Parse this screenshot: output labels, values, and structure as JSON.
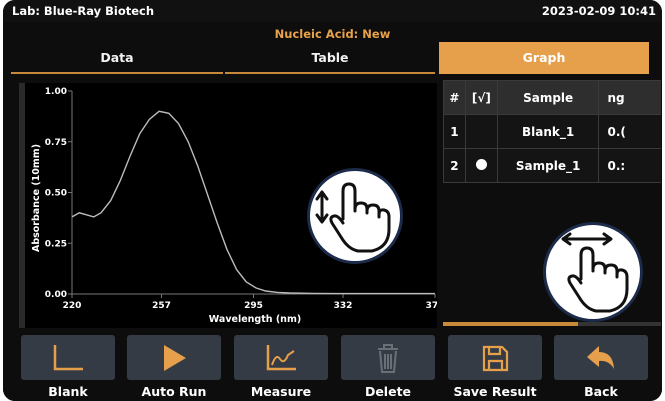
{
  "status": {
    "lab": "Lab: Blue-Ray Biotech",
    "datetime": "2023-02-09 10:41"
  },
  "mode_title": "Nucleic Acid: New",
  "tabs": [
    {
      "label": "Data"
    },
    {
      "label": "Table"
    },
    {
      "label": "Graph",
      "active": true
    }
  ],
  "colors": {
    "accent": "#e6a04c",
    "background": "#0d0d0d",
    "button": "#353b45",
    "curve": "#bbbbbb"
  },
  "chart_data": {
    "type": "line",
    "xlabel": "Wavelength (nm)",
    "ylabel": "Absorbance (10mm)",
    "xlim": [
      220,
      370
    ],
    "ylim": [
      0,
      1.0
    ],
    "x_ticks": [
      "220",
      "257",
      "295",
      "332",
      "370"
    ],
    "y_ticks": [
      "0.00",
      "0.25",
      "0.50",
      "0.75",
      "1.00"
    ],
    "series": [
      {
        "x": [
          220,
          223,
          226,
          229,
          232,
          236,
          240,
          244,
          248,
          252,
          256,
          260,
          264,
          268,
          272,
          276,
          280,
          284,
          288,
          292,
          296,
          300,
          305,
          310,
          320,
          330,
          345,
          360,
          370
        ],
        "y": [
          0.38,
          0.4,
          0.39,
          0.38,
          0.4,
          0.46,
          0.56,
          0.68,
          0.79,
          0.86,
          0.9,
          0.89,
          0.84,
          0.75,
          0.63,
          0.49,
          0.35,
          0.22,
          0.12,
          0.06,
          0.03,
          0.015,
          0.008,
          0.005,
          0.003,
          0.002,
          0.002,
          0.002,
          0.002
        ]
      }
    ]
  },
  "table": {
    "headers": [
      "#",
      "[√]",
      "Sample",
      "ng"
    ],
    "rows": [
      {
        "num": "1",
        "check": "",
        "sample": "Blank_1",
        "value": "0.("
      },
      {
        "num": "2",
        "check": "●",
        "sample": "Sample_1",
        "value": "0.:"
      }
    ]
  },
  "buttons": [
    {
      "label": "Blank",
      "icon": "blank-axis-icon"
    },
    {
      "label": "Auto Run",
      "icon": "play-icon"
    },
    {
      "label": "Measure",
      "icon": "measure-chart-icon"
    },
    {
      "label": "Delete",
      "icon": "trash-icon",
      "disabled": true
    },
    {
      "label": "Save Result",
      "icon": "save-icon"
    },
    {
      "label": "Back",
      "icon": "back-arrow-icon"
    }
  ],
  "gesture_hints": [
    {
      "icon": "vertical-swipe-hand-icon"
    },
    {
      "icon": "horizontal-swipe-hand-icon"
    }
  ]
}
